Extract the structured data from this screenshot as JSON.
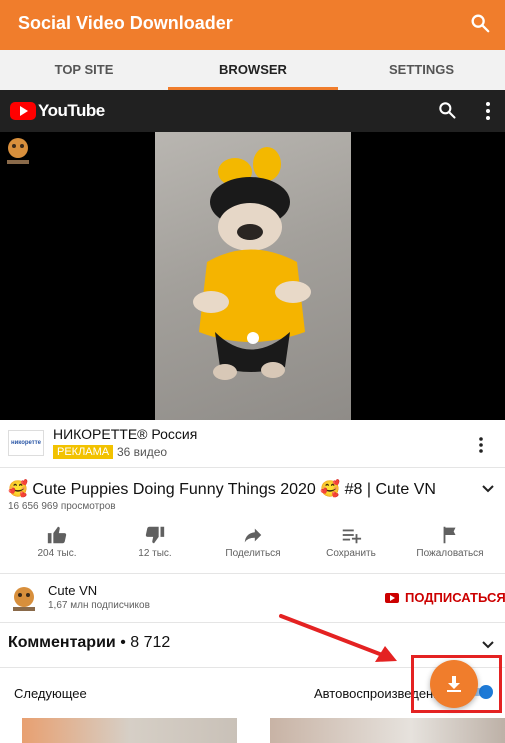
{
  "app": {
    "title": "Social Video Downloader"
  },
  "tabs": [
    {
      "label": "TOP SITE",
      "active": false
    },
    {
      "label": "BROWSER",
      "active": true
    },
    {
      "label": "SETTINGS",
      "active": false
    }
  ],
  "youtube": {
    "logo_text": "YouTube"
  },
  "ad": {
    "logo_text": "никоретте",
    "title": "НИКОРЕТТЕ® Россия",
    "badge": "РЕКЛАМА",
    "videos": "36 видео"
  },
  "video": {
    "title": "🥰 Cute Puppies Doing Funny Things 2020 🥰 #8 | Cute VN",
    "views": "16 656 969 просмотров"
  },
  "actions": [
    {
      "icon": "thumb-up-icon",
      "label": "204 тыс."
    },
    {
      "icon": "thumb-down-icon",
      "label": "12 тыс."
    },
    {
      "icon": "share-icon",
      "label": "Поделиться"
    },
    {
      "icon": "playlist-add-icon",
      "label": "Сохранить"
    },
    {
      "icon": "flag-icon",
      "label": "Пожаловаться"
    }
  ],
  "channel": {
    "name": "Cute VN",
    "subscribers": "1,67 млн подписчиков",
    "subscribe_label": "ПОДПИСАТЬСЯ"
  },
  "comments": {
    "label": "Комментарии",
    "count": "• 8 712"
  },
  "upnext": {
    "next_label": "Следующее",
    "autoplay_label": "Автовоспроизведение"
  },
  "colors": {
    "accent": "#f07d2c",
    "youtube_red": "#ff0000",
    "annotation": "#e42222"
  }
}
